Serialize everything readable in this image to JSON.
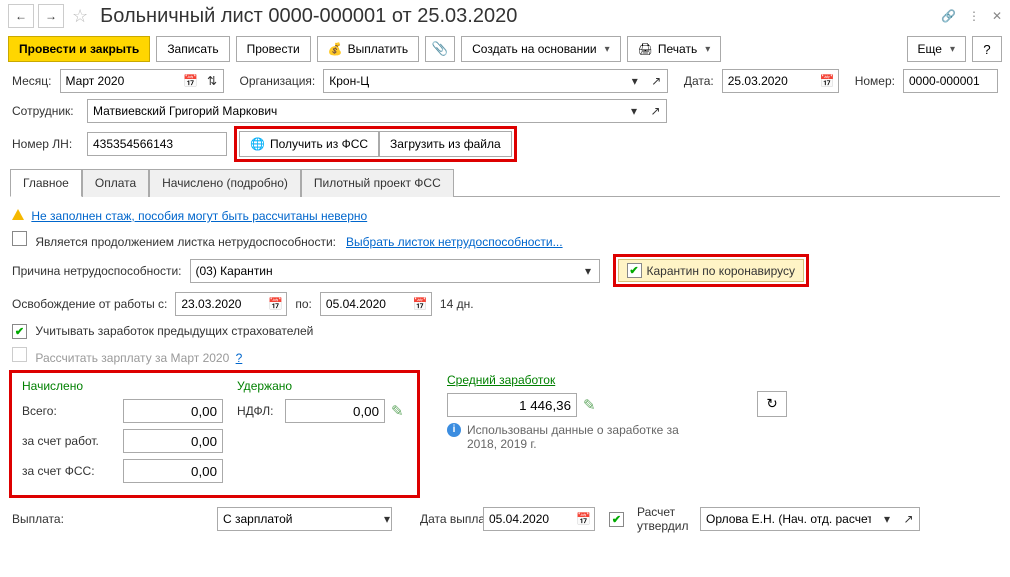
{
  "header": {
    "title": "Больничный лист 0000-000001 от 25.03.2020"
  },
  "toolbar": {
    "save_close": "Провести и закрыть",
    "save": "Записать",
    "post": "Провести",
    "pay": "Выплатить",
    "create_based": "Создать на основании",
    "print": "Печать",
    "more": "Еще"
  },
  "fields": {
    "month_label": "Месяц:",
    "month_value": "Март 2020",
    "org_label": "Организация:",
    "org_value": "Крон-Ц",
    "date_label": "Дата:",
    "date_value": "25.03.2020",
    "number_label": "Номер:",
    "number_value": "0000-000001",
    "employee_label": "Сотрудник:",
    "employee_value": "Матвиевский Григорий Маркович",
    "ln_label": "Номер ЛН:",
    "ln_value": "435354566143",
    "get_fss": "Получить из ФСС",
    "load_file": "Загрузить из файла"
  },
  "tabs": {
    "main": "Главное",
    "payment": "Оплата",
    "accrued": "Начислено (подробно)",
    "pilot": "Пилотный проект ФСС"
  },
  "main": {
    "warning_link": "Не заполнен стаж, пособия могут быть рассчитаны неверно",
    "is_continuation": "Является продолжением листка нетрудоспособности:",
    "select_sheet": "Выбрать листок нетрудоспособности...",
    "reason_label": "Причина нетрудоспособности:",
    "reason_value": "(03) Карантин",
    "corona": "Карантин по коронавирусу",
    "release_label": "Освобождение от работы с:",
    "release_from": "23.03.2020",
    "to_label": "по:",
    "release_to": "05.04.2020",
    "days": "14 дн.",
    "prev_insurers": "Учитывать заработок предыдущих страхователей",
    "calc_salary": "Рассчитать зарплату за Март 2020"
  },
  "calc": {
    "accrued_header": "Начислено",
    "withheld_header": "Удержано",
    "avg_header": "Средний заработок",
    "total_label": "Всего:",
    "total_value": "0,00",
    "emp_label": "за счет работ.",
    "emp_value": "0,00",
    "fss_label": "за счет ФСС:",
    "fss_value": "0,00",
    "ndfl_label": "НДФЛ:",
    "ndfl_value": "0,00",
    "avg_value": "1 446,36",
    "info_text": "Использованы данные о заработке за 2018,   2019 г."
  },
  "footer": {
    "payment_label": "Выплата:",
    "payment_value": "С зарплатой",
    "paydate_label": "Дата выплаты:",
    "paydate_value": "05.04.2020",
    "approved": "Расчет утвердил",
    "approver": "Орлова Е.Н. (Нач. отд. расчет"
  }
}
